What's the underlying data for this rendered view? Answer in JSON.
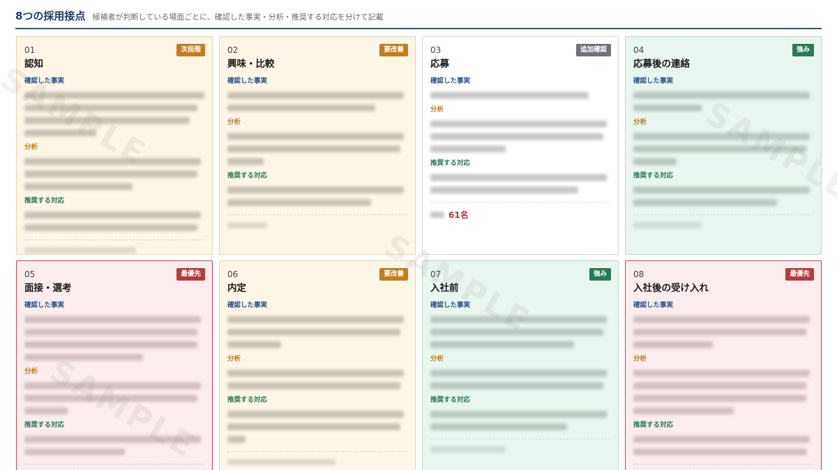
{
  "header": {
    "title": "8つの採用接点",
    "subtitle": "候補者が判断している場面ごとに、確認した事実・分析・推奨する対応を分けて記載"
  },
  "section_labels": {
    "fact": "確認した事実",
    "analysis": "分析",
    "action": "推奨する対応"
  },
  "watermark": "SAMPLE",
  "cards": [
    {
      "num": "01",
      "stage": "認知",
      "badge": "次段階",
      "theme": "orange",
      "badge_color": "#c27d1e"
    },
    {
      "num": "02",
      "stage": "興味・比較",
      "badge": "要改善",
      "theme": "orange",
      "badge_color": "#c27d1e"
    },
    {
      "num": "03",
      "stage": "応募",
      "badge": "追加確認",
      "theme": "white",
      "badge_color": "#6e737b",
      "applicants_value": "61名"
    },
    {
      "num": "04",
      "stage": "応募後の連絡",
      "badge": "強み",
      "theme": "green",
      "badge_color": "#2b7a55"
    },
    {
      "num": "05",
      "stage": "面接・選考",
      "badge": "最優先",
      "theme": "red",
      "badge_color": "#b83a3f"
    },
    {
      "num": "06",
      "stage": "内定",
      "badge": "要改善",
      "theme": "orange",
      "badge_color": "#c27d1e"
    },
    {
      "num": "07",
      "stage": "入社前",
      "badge": "強み",
      "theme": "green",
      "badge_color": "#2b7a55"
    },
    {
      "num": "08",
      "stage": "入社後の受け入れ",
      "badge": "最優先",
      "theme": "red",
      "badge_color": "#b83a3f"
    }
  ]
}
